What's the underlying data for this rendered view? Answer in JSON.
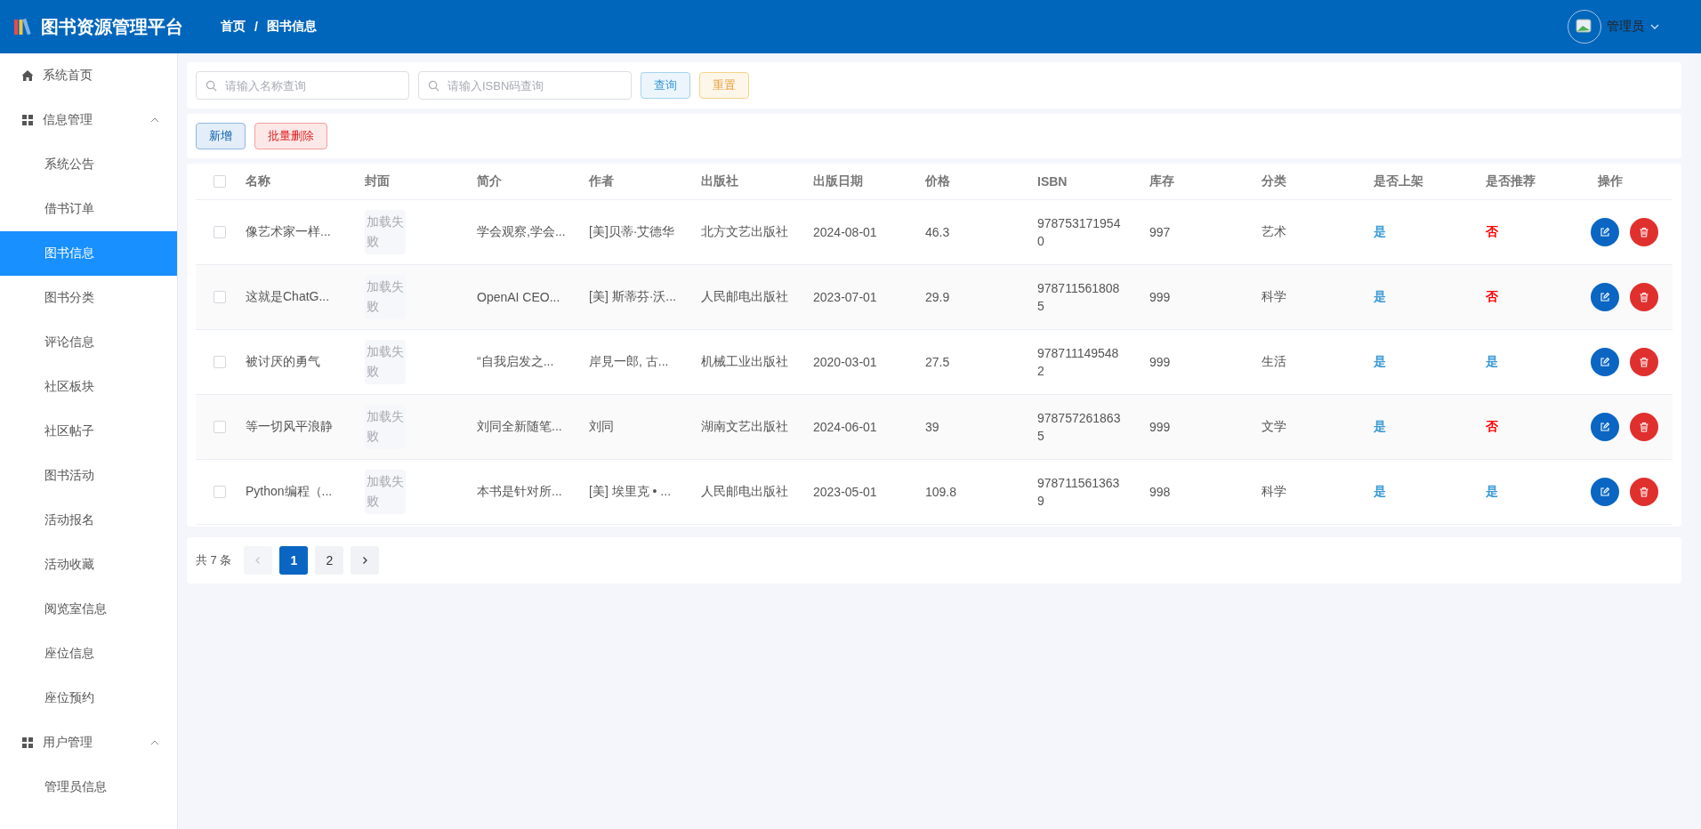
{
  "header": {
    "title": "图书资源管理平台",
    "breadcrumb": [
      "首页",
      "图书信息"
    ],
    "breadcrumb_separator": "/",
    "user": "管理员"
  },
  "sidebar": {
    "items": [
      {
        "label": "系统首页",
        "kind": "link",
        "selected": false
      },
      {
        "label": "信息管理",
        "kind": "group",
        "expanded": true,
        "children": [
          {
            "label": "系统公告",
            "selected": false
          },
          {
            "label": "借书订单",
            "selected": false
          },
          {
            "label": "图书信息",
            "selected": true
          },
          {
            "label": "图书分类",
            "selected": false
          },
          {
            "label": "评论信息",
            "selected": false
          },
          {
            "label": "社区板块",
            "selected": false
          },
          {
            "label": "社区帖子",
            "selected": false
          },
          {
            "label": "图书活动",
            "selected": false
          },
          {
            "label": "活动报名",
            "selected": false
          },
          {
            "label": "活动收藏",
            "selected": false
          },
          {
            "label": "阅览室信息",
            "selected": false
          },
          {
            "label": "座位信息",
            "selected": false
          },
          {
            "label": "座位预约",
            "selected": false
          }
        ]
      },
      {
        "label": "用户管理",
        "kind": "group",
        "expanded": true,
        "children": [
          {
            "label": "管理员信息",
            "selected": false
          }
        ]
      }
    ]
  },
  "search": {
    "fields": [
      {
        "placeholder": "请输入名称查询"
      },
      {
        "placeholder": "请输入ISBN码查询"
      }
    ],
    "buttons": [
      {
        "label": "查询",
        "kind": "primary"
      },
      {
        "label": "重置",
        "kind": "warning"
      }
    ]
  },
  "toolbar": {
    "buttons": [
      {
        "label": "新增",
        "kind": "primary"
      },
      {
        "label": "批量删除",
        "kind": "danger"
      }
    ]
  },
  "table": {
    "select_all_checked": false,
    "columns": [
      "名称",
      "封面",
      "简介",
      "作者",
      "出版社",
      "出版日期",
      "价格",
      "ISBN",
      "库存",
      "分类",
      "是否上架",
      "是否推荐",
      "操作"
    ],
    "rows": [
      {
        "checked": false,
        "name": "像艺术家一样...",
        "cover": "加载失败",
        "intro": "学会观察,学会...",
        "author": "[美]贝蒂·艾德华",
        "publisher": "北方文艺出版社",
        "date": "2024-08-01",
        "price": "46.3",
        "isbn": "9787531719540",
        "stock": "997",
        "category": "艺术",
        "on_shelf": {
          "text": "是",
          "on": true
        },
        "recommended": {
          "text": "否",
          "on": false
        }
      },
      {
        "checked": false,
        "name": "这就是ChatG...",
        "cover": "加载失败",
        "intro": "OpenAI CEO...",
        "author": "[美] 斯蒂芬·沃...",
        "publisher": "人民邮电出版社",
        "date": "2023-07-01",
        "price": "29.9",
        "isbn": "9787115618085",
        "stock": "999",
        "category": "科学",
        "on_shelf": {
          "text": "是",
          "on": true
        },
        "recommended": {
          "text": "否",
          "on": false
        }
      },
      {
        "checked": false,
        "name": "被讨厌的勇气",
        "cover": "加载失败",
        "intro": "“自我启发之...",
        "author": "岸見一郎, 古...",
        "publisher": "机械工业出版社",
        "date": "2020-03-01",
        "price": "27.5",
        "isbn": "9787111495482",
        "stock": "999",
        "category": "生活",
        "on_shelf": {
          "text": "是",
          "on": true
        },
        "recommended": {
          "text": "是",
          "on": true
        }
      },
      {
        "checked": false,
        "name": "等一切风平浪静",
        "cover": "加载失败",
        "intro": "刘同全新随笔...",
        "author": "刘同",
        "publisher": "湖南文艺出版社",
        "date": "2024-06-01",
        "price": "39",
        "isbn": "9787572618635",
        "stock": "999",
        "category": "文学",
        "on_shelf": {
          "text": "是",
          "on": true
        },
        "recommended": {
          "text": "否",
          "on": false
        }
      },
      {
        "checked": false,
        "name": "Python编程（...",
        "cover": "加载失败",
        "intro": "本书是针对所...",
        "author": "[美] 埃里克 • ...",
        "publisher": "人民邮电出版社",
        "date": "2023-05-01",
        "price": "109.8",
        "isbn": "9787115613639",
        "stock": "998",
        "category": "科学",
        "on_shelf": {
          "text": "是",
          "on": true
        },
        "recommended": {
          "text": "是",
          "on": true
        }
      }
    ]
  },
  "pagination": {
    "total": "共 7 条",
    "pages": [
      {
        "label": "1",
        "selected": true
      },
      {
        "label": "2",
        "selected": false
      }
    ],
    "prev_disabled": true
  }
}
